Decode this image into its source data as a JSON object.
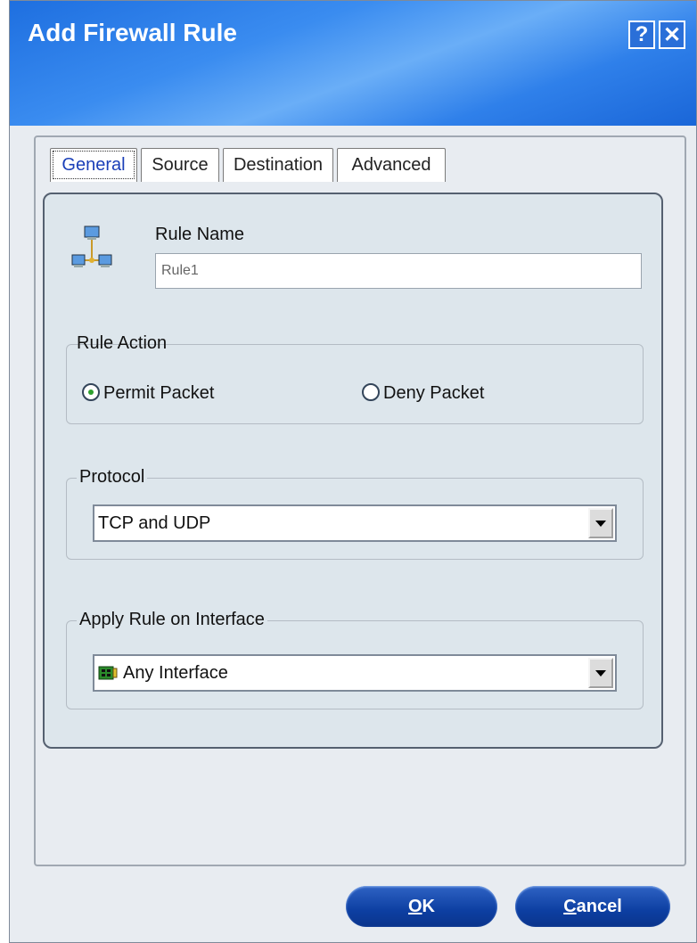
{
  "window": {
    "title": "Add Firewall Rule",
    "help_label": "?",
    "close_label": "✕"
  },
  "tabs": [
    {
      "label": "General",
      "active": true
    },
    {
      "label": "Source",
      "active": false
    },
    {
      "label": "Destination",
      "active": false
    },
    {
      "label": "Advanced",
      "active": false
    }
  ],
  "general": {
    "icon": "network-computers-icon",
    "rule_name_label": "Rule Name",
    "rule_name_value": "Rule1",
    "rule_action": {
      "legend": "Rule Action",
      "options": [
        {
          "label": "Permit Packet",
          "selected": true
        },
        {
          "label": "Deny Packet",
          "selected": false
        }
      ]
    },
    "protocol": {
      "legend": "Protocol",
      "selected": "TCP and UDP"
    },
    "interface": {
      "legend": "Apply Rule on Interface",
      "selected": "Any Interface",
      "icon": "network-card-icon"
    }
  },
  "buttons": {
    "ok": {
      "accel": "O",
      "rest": "K"
    },
    "cancel": {
      "accel": "C",
      "rest": "ancel"
    }
  },
  "colors": {
    "title_gradient": "#2f80ea",
    "button_blue": "#0d3fa2",
    "panel_bg": "#dde6ec"
  }
}
